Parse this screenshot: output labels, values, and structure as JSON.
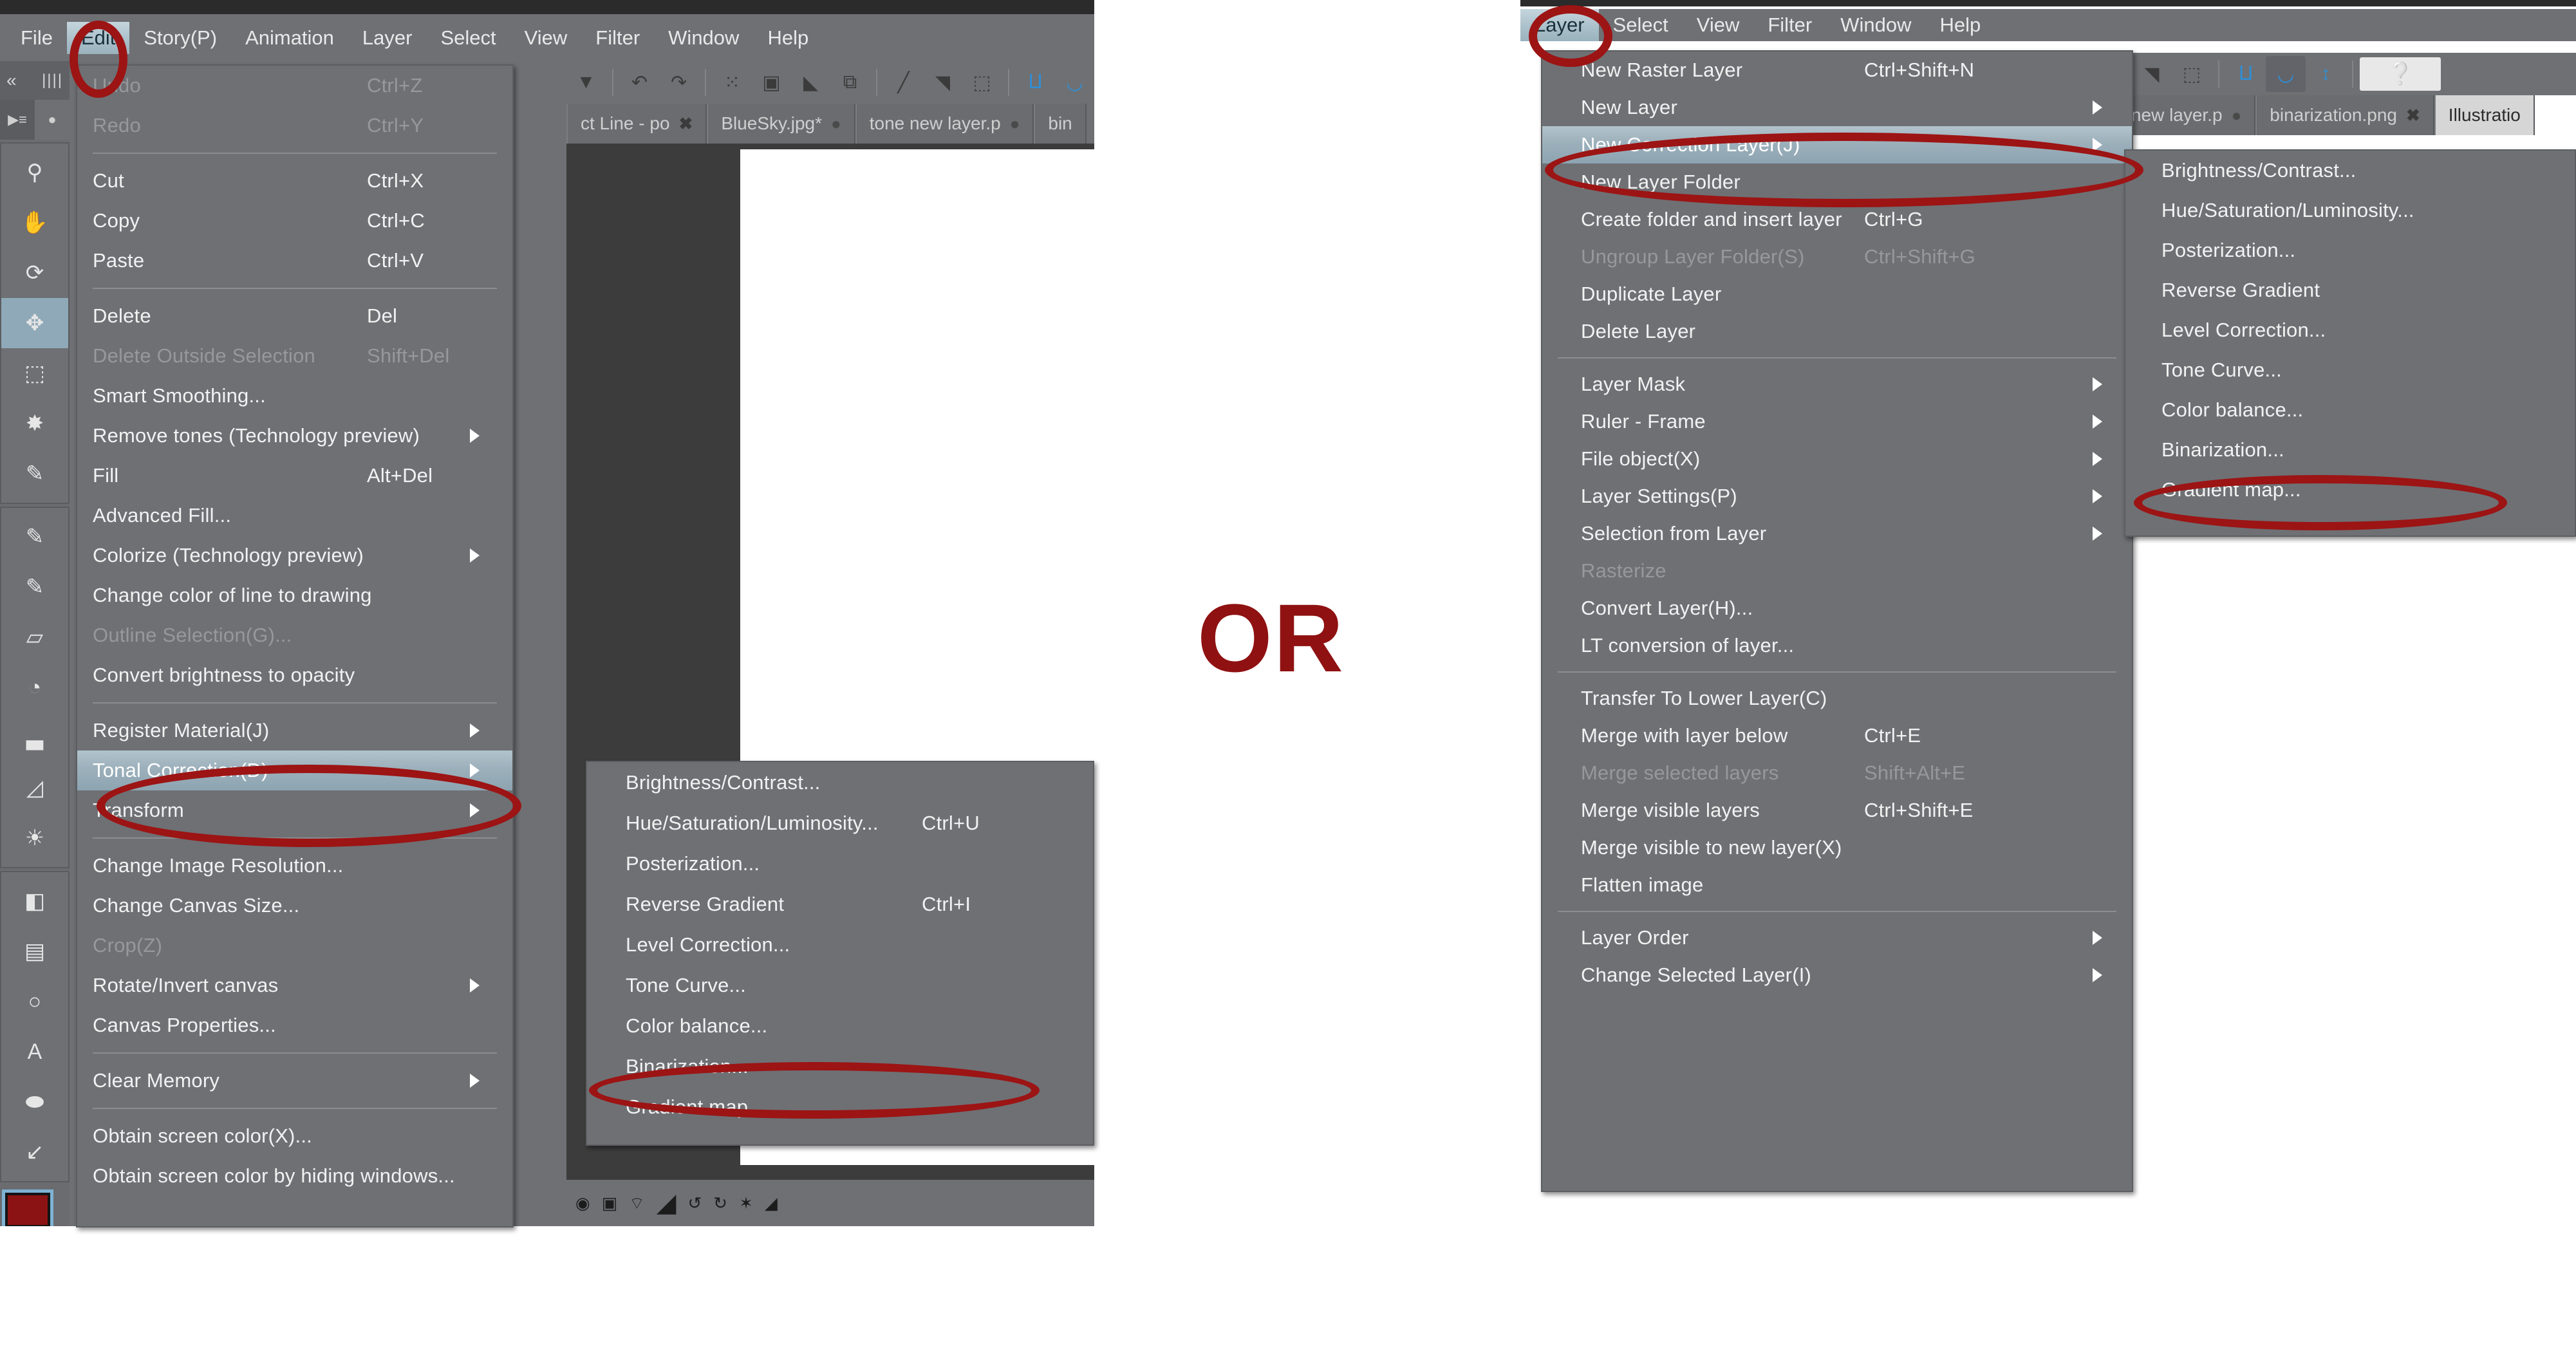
{
  "left_window": {
    "menubar": {
      "items": [
        {
          "label": "File",
          "active": false
        },
        {
          "label": "Edit",
          "active": true
        },
        {
          "label": "Story(P)",
          "active": false
        },
        {
          "label": "Animation",
          "active": false
        },
        {
          "label": "Layer",
          "active": false
        },
        {
          "label": "Select",
          "active": false
        },
        {
          "label": "View",
          "active": false
        },
        {
          "label": "Filter",
          "active": false
        },
        {
          "label": "Window",
          "active": false
        },
        {
          "label": "Help",
          "active": false
        }
      ]
    },
    "doc_tabs": [
      {
        "label": "ct Line - po",
        "close": "✖",
        "active": false
      },
      {
        "label": "BlueSky.jpg*",
        "close": "●",
        "active": false
      },
      {
        "label": "tone new layer.p",
        "close": "●",
        "active": false
      },
      {
        "label": "bin",
        "close": "",
        "active": false
      }
    ],
    "edit_menu": {
      "items": [
        {
          "label": "Undo",
          "accel": "Ctrl+Z",
          "disabled": true,
          "submenu": false
        },
        {
          "label": "Redo",
          "accel": "Ctrl+Y",
          "disabled": true,
          "submenu": false
        },
        {
          "type": "separator"
        },
        {
          "label": "Cut",
          "accel": "Ctrl+X",
          "disabled": false,
          "submenu": false
        },
        {
          "label": "Copy",
          "accel": "Ctrl+C",
          "disabled": false,
          "submenu": false
        },
        {
          "label": "Paste",
          "accel": "Ctrl+V",
          "disabled": false,
          "submenu": false
        },
        {
          "type": "separator"
        },
        {
          "label": "Delete",
          "accel": "Del",
          "disabled": false,
          "submenu": false
        },
        {
          "label": "Delete Outside Selection",
          "accel": "Shift+Del",
          "disabled": true,
          "submenu": false
        },
        {
          "label": "Smart Smoothing...",
          "accel": "",
          "disabled": false,
          "submenu": false
        },
        {
          "label": "Remove tones (Technology preview)",
          "accel": "",
          "disabled": false,
          "submenu": true
        },
        {
          "label": "Fill",
          "accel": "Alt+Del",
          "disabled": false,
          "submenu": false
        },
        {
          "label": "Advanced Fill...",
          "accel": "",
          "disabled": false,
          "submenu": false
        },
        {
          "label": "Colorize (Technology preview)",
          "accel": "",
          "disabled": false,
          "submenu": true
        },
        {
          "label": "Change color of line to drawing",
          "accel": "",
          "disabled": false,
          "submenu": false
        },
        {
          "label": "Outline Selection(G)...",
          "accel": "",
          "disabled": true,
          "submenu": false
        },
        {
          "label": "Convert brightness to opacity",
          "accel": "",
          "disabled": false,
          "submenu": false
        },
        {
          "type": "separator"
        },
        {
          "label": "Register Material(J)",
          "accel": "",
          "disabled": false,
          "submenu": true
        },
        {
          "label": "Tonal Correction(D)",
          "accel": "",
          "disabled": false,
          "submenu": true,
          "highlighted": true
        },
        {
          "label": "Transform",
          "accel": "",
          "disabled": false,
          "submenu": true
        },
        {
          "type": "separator"
        },
        {
          "label": "Change Image Resolution...",
          "accel": "",
          "disabled": false,
          "submenu": false
        },
        {
          "label": "Change Canvas Size...",
          "accel": "",
          "disabled": false,
          "submenu": false
        },
        {
          "label": "Crop(Z)",
          "accel": "",
          "disabled": true,
          "submenu": false
        },
        {
          "label": "Rotate/Invert canvas",
          "accel": "",
          "disabled": false,
          "submenu": true
        },
        {
          "label": "Canvas Properties...",
          "accel": "",
          "disabled": false,
          "submenu": false
        },
        {
          "type": "separator"
        },
        {
          "label": "Clear Memory",
          "accel": "",
          "disabled": false,
          "submenu": true
        },
        {
          "type": "separator"
        },
        {
          "label": "Obtain screen color(X)...",
          "accel": "",
          "disabled": false,
          "submenu": false
        },
        {
          "label": "Obtain screen color by hiding windows...",
          "accel": "",
          "disabled": false,
          "submenu": false
        }
      ]
    },
    "tonal_correction_submenu": {
      "items": [
        {
          "label": "Brightness/Contrast...",
          "accel": ""
        },
        {
          "label": "Hue/Saturation/Luminosity...",
          "accel": "Ctrl+U"
        },
        {
          "label": "Posterization...",
          "accel": ""
        },
        {
          "label": "Reverse Gradient",
          "accel": "Ctrl+I"
        },
        {
          "label": "Level Correction...",
          "accel": ""
        },
        {
          "label": "Tone Curve...",
          "accel": ""
        },
        {
          "label": "Color balance...",
          "accel": ""
        },
        {
          "label": "Binarization...",
          "accel": "",
          "annotated": true
        },
        {
          "label": "Gradient map...",
          "accel": ""
        }
      ]
    }
  },
  "right_window": {
    "menubar": {
      "items": [
        {
          "label": "Layer",
          "active": true
        },
        {
          "label": "Select",
          "active": false
        },
        {
          "label": "View",
          "active": false
        },
        {
          "label": "Filter",
          "active": false
        },
        {
          "label": "Window",
          "active": false
        },
        {
          "label": "Help",
          "active": false
        }
      ]
    },
    "doc_tabs": [
      {
        "label": "ne new layer.p",
        "close": "●",
        "active": false
      },
      {
        "label": "binarization.png",
        "close": "✖",
        "active": false
      },
      {
        "label": "Illustratio",
        "close": "",
        "active": true
      }
    ],
    "layer_menu": {
      "items": [
        {
          "label": "New Raster Layer",
          "accel": "Ctrl+Shift+N",
          "disabled": false,
          "submenu": false
        },
        {
          "label": "New Layer",
          "accel": "",
          "disabled": false,
          "submenu": true
        },
        {
          "label": "New Correction Layer(J)",
          "accel": "",
          "disabled": false,
          "submenu": true,
          "highlighted": true
        },
        {
          "label": "New Layer Folder",
          "accel": "",
          "disabled": false,
          "submenu": false
        },
        {
          "label": "Create folder and insert layer",
          "accel": "Ctrl+G",
          "disabled": false,
          "submenu": false
        },
        {
          "label": "Ungroup Layer Folder(S)",
          "accel": "Ctrl+Shift+G",
          "disabled": true,
          "submenu": false
        },
        {
          "label": "Duplicate Layer",
          "accel": "",
          "disabled": false,
          "submenu": false
        },
        {
          "label": "Delete Layer",
          "accel": "",
          "disabled": false,
          "submenu": false
        },
        {
          "type": "separator"
        },
        {
          "label": "Layer Mask",
          "accel": "",
          "disabled": false,
          "submenu": true
        },
        {
          "label": "Ruler - Frame",
          "accel": "",
          "disabled": false,
          "submenu": true
        },
        {
          "label": "File object(X)",
          "accel": "",
          "disabled": false,
          "submenu": true
        },
        {
          "label": "Layer Settings(P)",
          "accel": "",
          "disabled": false,
          "submenu": true
        },
        {
          "label": "Selection from Layer",
          "accel": "",
          "disabled": false,
          "submenu": true
        },
        {
          "label": "Rasterize",
          "accel": "",
          "disabled": true,
          "submenu": false
        },
        {
          "label": "Convert Layer(H)...",
          "accel": "",
          "disabled": false,
          "submenu": false
        },
        {
          "label": "LT conversion of layer...",
          "accel": "",
          "disabled": false,
          "submenu": false
        },
        {
          "type": "separator"
        },
        {
          "label": "Transfer To Lower Layer(C)",
          "accel": "",
          "disabled": false,
          "submenu": false
        },
        {
          "label": "Merge with layer below",
          "accel": "Ctrl+E",
          "disabled": false,
          "submenu": false
        },
        {
          "label": "Merge selected layers",
          "accel": "Shift+Alt+E",
          "disabled": true,
          "submenu": false
        },
        {
          "label": "Merge visible layers",
          "accel": "Ctrl+Shift+E",
          "disabled": false,
          "submenu": false
        },
        {
          "label": "Merge visible to new layer(X)",
          "accel": "",
          "disabled": false,
          "submenu": false
        },
        {
          "label": "Flatten image",
          "accel": "",
          "disabled": false,
          "submenu": false
        },
        {
          "type": "separator"
        },
        {
          "label": "Layer Order",
          "accel": "",
          "disabled": false,
          "submenu": true
        },
        {
          "label": "Change Selected Layer(I)",
          "accel": "",
          "disabled": false,
          "submenu": true
        }
      ]
    },
    "new_correction_layer_submenu": {
      "items": [
        {
          "label": "Brightness/Contrast...",
          "accel": ""
        },
        {
          "label": "Hue/Saturation/Luminosity...",
          "accel": ""
        },
        {
          "label": "Posterization...",
          "accel": ""
        },
        {
          "label": "Reverse Gradient",
          "accel": ""
        },
        {
          "label": "Level Correction...",
          "accel": ""
        },
        {
          "label": "Tone Curve...",
          "accel": ""
        },
        {
          "label": "Color balance...",
          "accel": ""
        },
        {
          "label": "Binarization...",
          "accel": "",
          "annotated": true
        },
        {
          "label": "Gradient map...",
          "accel": ""
        }
      ]
    }
  },
  "annotation": {
    "or_label": "OR",
    "highlight_color": "#9c1414",
    "or_color": "#8f1111"
  },
  "tool_palette": {
    "collapse_icon": "«",
    "grip_icon": "‖‖",
    "tabs": [
      {
        "name": "tool-list-tab",
        "glyph": "▶≡"
      },
      {
        "name": "sub-tool-tab",
        "glyph": "♁"
      }
    ],
    "tools": [
      {
        "name": "zoom-tool",
        "glyph": "⌕"
      },
      {
        "name": "hand-tool",
        "glyph": "✋"
      },
      {
        "name": "rotate-tool",
        "glyph": "⟳"
      },
      {
        "name": "move-tool",
        "glyph": "✥",
        "selected": true
      },
      {
        "name": "selection-tool",
        "glyph": "⬚"
      },
      {
        "name": "auto-select-tool",
        "glyph": "✸"
      },
      {
        "name": "eyedropper-tool",
        "glyph": "✎"
      },
      {
        "name": "pen-tool",
        "glyph": "✐"
      },
      {
        "name": "brush-tool",
        "glyph": "✒"
      },
      {
        "name": "eraser-tool",
        "glyph": "▱"
      },
      {
        "name": "airbrush-tool",
        "glyph": "◔"
      },
      {
        "name": "blend-tool",
        "glyph": "▃"
      },
      {
        "name": "fill-tool",
        "glyph": "◧"
      },
      {
        "name": "gradient-tool",
        "glyph": "▤"
      },
      {
        "name": "figure-tool",
        "glyph": "○"
      },
      {
        "name": "text-tool",
        "glyph": "A"
      },
      {
        "name": "balloon-tool",
        "glyph": "⬬"
      },
      {
        "name": "correct-line-tool",
        "glyph": "↙"
      }
    ],
    "foreground_color": "#8c1313",
    "background_color": "#d4d4d4"
  },
  "toolbar_icons": {
    "left": [
      {
        "name": "dropdown-arrow-icon",
        "glyph": "▼"
      },
      {
        "name": "undo-icon",
        "glyph": "↶"
      },
      {
        "name": "redo-icon",
        "glyph": "↷"
      },
      {
        "name": "dots-icon",
        "glyph": "⁙"
      },
      {
        "name": "selection-box-icon",
        "glyph": "▣"
      },
      {
        "name": "fill-bucket-icon",
        "glyph": "◣"
      },
      {
        "name": "transform-icon",
        "glyph": "⧉"
      },
      {
        "name": "no-ruler-icon",
        "glyph": "╱"
      },
      {
        "name": "ruler-icon",
        "glyph": "◥"
      },
      {
        "name": "dashed-box-icon",
        "glyph": "⬚"
      },
      {
        "name": "snap-line-icon",
        "glyph": "⨿"
      }
    ],
    "right": [
      {
        "name": "no-ruler-icon",
        "glyph": "╱"
      },
      {
        "name": "ruler-icon",
        "glyph": "◥"
      },
      {
        "name": "dashed-box-icon",
        "glyph": "⬚"
      },
      {
        "name": "snap-line-icon",
        "glyph": "⨿"
      },
      {
        "name": "snap-curve-icon",
        "glyph": "◡"
      },
      {
        "name": "snap-symmetry-icon",
        "glyph": "↕"
      },
      {
        "name": "help-icon",
        "glyph": "?"
      }
    ]
  },
  "statusbar_icons": [
    {
      "name": "eye-icon",
      "glyph": "◉"
    },
    {
      "name": "page-icon",
      "glyph": "▣"
    },
    {
      "name": "zoom-value-icon",
      "glyph": "⌔"
    },
    {
      "name": "rotate-left-icon",
      "glyph": "↺"
    },
    {
      "name": "rotate-right-icon",
      "glyph": "↻"
    },
    {
      "name": "reset-icon",
      "glyph": "✶"
    },
    {
      "name": "flip-icon",
      "glyph": "◢"
    }
  ]
}
